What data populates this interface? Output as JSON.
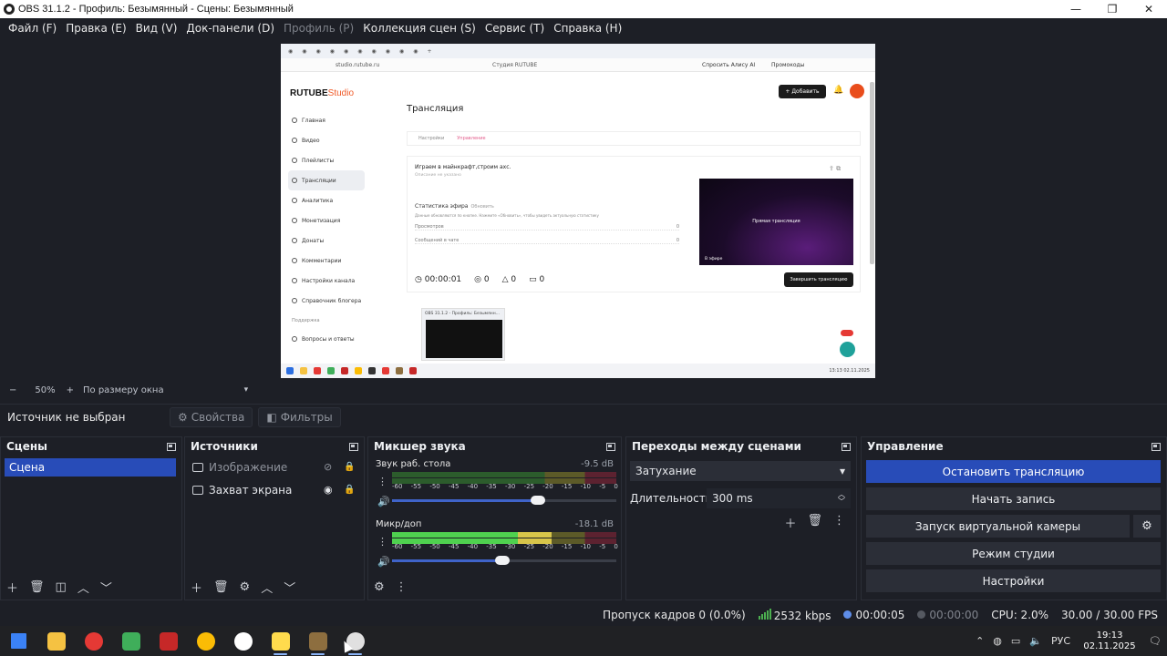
{
  "window": {
    "title": "OBS 31.1.2 - Профиль: Безымянный - Сцены: Безымянный",
    "minimize": "—",
    "maximize": "❐",
    "close": "✕"
  },
  "menu": [
    {
      "label": "Файл (F)",
      "enabled": true
    },
    {
      "label": "Правка (E)",
      "enabled": true
    },
    {
      "label": "Вид (V)",
      "enabled": true
    },
    {
      "label": "Док-панели (D)",
      "enabled": true
    },
    {
      "label": "Профиль (P)",
      "enabled": false
    },
    {
      "label": "Коллекция сцен (S)",
      "enabled": true
    },
    {
      "label": "Сервис (T)",
      "enabled": true
    },
    {
      "label": "Справка (H)",
      "enabled": true
    }
  ],
  "preview": {
    "browser": {
      "url": "studio.rutube.ru",
      "page_title": "Студия RUTUBE",
      "alice": "Спросить Алису AI",
      "promo": "Промокоды"
    },
    "studio": {
      "logo_main": "RUTUBE",
      "logo_sub": "Studio",
      "add_button": "+ Добавить",
      "nav": [
        "Главная",
        "Видео",
        "Плейлисты",
        "Трансляции",
        "Аналитика",
        "Монетизация",
        "Донаты",
        "Комментарии",
        "Настройки канала",
        "Справочник блогера"
      ],
      "nav_active_index": 3,
      "nav_section": "Поддержка",
      "nav_support": "Вопросы и ответы",
      "heading": "Трансляция",
      "subtab_settings": "Настройки",
      "subtab_active": "Управление",
      "stream_title": "Играем в майнкрафт,строим ахс.",
      "desc_placeholder": "Описание не указано",
      "stats_title": "Статистика эфира",
      "stats_refresh": "Обновить",
      "stats_note": "Данные обновляются по кнопке. Нажмите «Обновить», чтобы увидеть актуальную статистику",
      "stats_rows": [
        {
          "label": "Просмотров",
          "value": "0"
        },
        {
          "label": "Сообщений в чате",
          "value": "0"
        }
      ],
      "timer": "00:00:01",
      "views": "0",
      "likes": "0",
      "comments": "0",
      "player_text": "Прямая трансляция",
      "live_badge": "В эфире",
      "end_button": "Завершить трансляцию",
      "popup_title": "OBS 31.1.2 - Профиль: Безымянн..."
    },
    "tray_time": "13:13",
    "tray_date": "02.11.2025"
  },
  "preview_toolbar": {
    "zoom_minus": "−",
    "zoom": "50%",
    "zoom_plus": "+",
    "fit_mode": "По размеру окна",
    "caret": "▾"
  },
  "source_bar": {
    "no_source": "Источник не выбран",
    "properties": "Свойства",
    "filters": "Фильтры"
  },
  "scenes": {
    "title": "Сцены",
    "items": [
      "Сцена"
    ]
  },
  "sources": {
    "title": "Источники",
    "items": [
      {
        "name": "Изображение",
        "visible": false
      },
      {
        "name": "Захват экрана",
        "visible": true
      }
    ]
  },
  "mixer": {
    "title": "Микшер звука",
    "scale": [
      "-60",
      "-55",
      "-50",
      "-45",
      "-40",
      "-35",
      "-30",
      "-25",
      "-20",
      "-15",
      "-10",
      "-5",
      "0"
    ],
    "channels": [
      {
        "name": "Звук раб. стола",
        "db": "-9.5 dB",
        "volume": 0.65,
        "level": 0
      },
      {
        "name": "Микр/доп",
        "db": "-18.1 dB",
        "volume": 0.49,
        "level": 0.71
      }
    ]
  },
  "transitions": {
    "title": "Переходы между сценами",
    "selected": "Затухание",
    "duration_label": "Длительность",
    "duration": "300 ms"
  },
  "controls": {
    "title": "Управление",
    "stop_stream": "Остановить трансляцию",
    "start_record": "Начать запись",
    "virtual_cam": "Запуск виртуальной камеры",
    "studio_mode": "Режим студии",
    "settings": "Настройки"
  },
  "status": {
    "dropped": "Пропуск кадров 0 (0.0%)",
    "bitrate": "2532 kbps",
    "stream_time": "00:00:05",
    "record_time": "00:00:00",
    "cpu": "CPU: 2.0%",
    "fps": "30.00 / 30.00 FPS"
  },
  "taskbar": {
    "apps": [
      {
        "name": "start-button",
        "color": "#3b82f6"
      },
      {
        "name": "explorer",
        "color": "#f5c242"
      },
      {
        "name": "yandex",
        "color": "#e53935"
      },
      {
        "name": "antivirus",
        "color": "#3fae5a"
      },
      {
        "name": "app-red",
        "color": "#c62828"
      },
      {
        "name": "chrome",
        "color": "#fbbc05"
      },
      {
        "name": "unreal",
        "color": "#ffffff"
      },
      {
        "name": "yandex-browser",
        "color": "#ffdb4d"
      },
      {
        "name": "minecraft",
        "color": "#8d6e3f"
      },
      {
        "name": "obs",
        "color": "#e0e0e0"
      }
    ],
    "lang": "РУС",
    "time": "19:13",
    "date": "02.11.2025"
  },
  "colors": {
    "accent": "#284cb8",
    "bg": "#1d1f26",
    "meter_green": "#4fd14f",
    "meter_yellow": "#d7c54a",
    "meter_red": "#c0392b"
  }
}
